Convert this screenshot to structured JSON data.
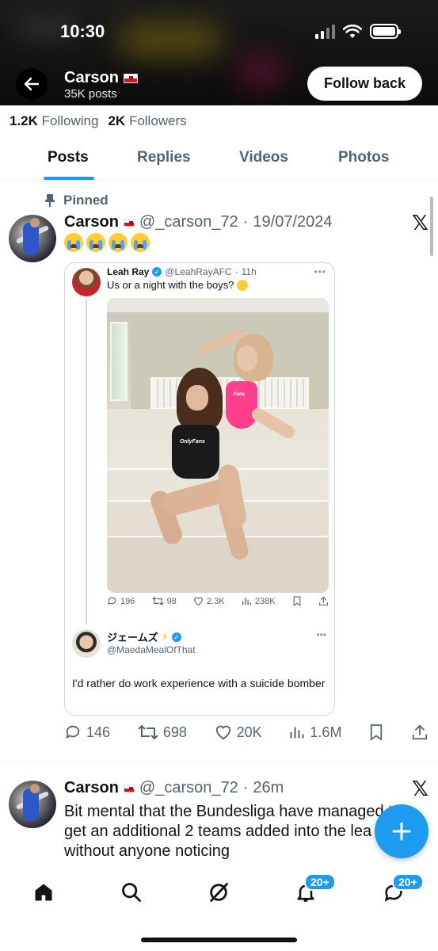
{
  "status_bar": {
    "time": "10:30"
  },
  "header": {
    "name": "Carson",
    "posts_count": "35K posts",
    "follow_button": "Follow back"
  },
  "profile": {
    "following_count": "1.2K",
    "following_label": "Following",
    "followers_count": "2K",
    "followers_label": "Followers"
  },
  "tabs": [
    {
      "label": "Posts",
      "active": true
    },
    {
      "label": "Replies",
      "active": false
    },
    {
      "label": "Videos",
      "active": false
    },
    {
      "label": "Photos",
      "active": false
    }
  ],
  "pinned_post": {
    "pinned_label": "Pinned",
    "author": "Carson",
    "handle": "@_carson_72",
    "separator": "·",
    "date": "19/07/2024",
    "emoji": [
      "crying-face",
      "crying-face",
      "crying-face",
      "crying-face"
    ],
    "quote": {
      "author": "Leah Ray",
      "handle": "@LeahRayAFC",
      "time": "11h",
      "text": "Us or a night with the boys?",
      "photo_caption": "OnlyFans",
      "photo_caption_2": "Fans",
      "actions": {
        "replies": "196",
        "reposts": "98",
        "likes": "2.3K",
        "views": "238K"
      },
      "reply": {
        "author": "ジェームズ",
        "handle": "@MaedaMealOfThat",
        "text": "I'd rather do work experience with a suicide bomber"
      }
    },
    "actions": {
      "replies": "146",
      "reposts": "698",
      "likes": "20K",
      "views": "1.6M"
    }
  },
  "second_post": {
    "author": "Carson",
    "handle": "@_carson_72",
    "separator": "·",
    "time": "26m",
    "lines": [
      "Bit mental that the Bundesliga have managed t",
      "get an additional 2 teams added into the lea",
      "without anyone noticing"
    ]
  },
  "bottom_nav": {
    "notifications_badge": "20+",
    "messages_badge": "20+"
  },
  "colors": {
    "accent": "#1d9bf0",
    "text": "#0f1419",
    "secondary": "#536471"
  }
}
